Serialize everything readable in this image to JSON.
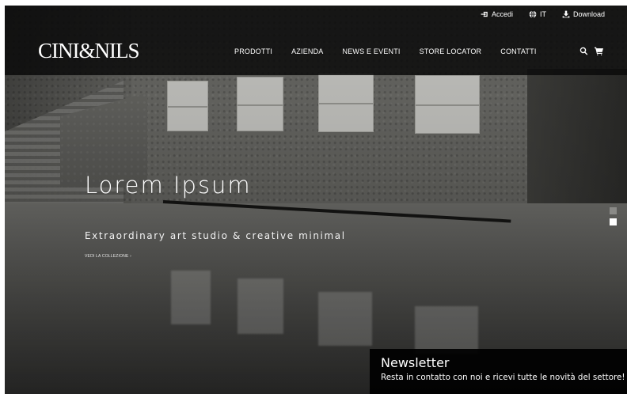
{
  "header": {
    "logo": "CINI&NILS",
    "top_links": [
      {
        "label": "Accedi",
        "icon": "login-icon"
      },
      {
        "label": "IT",
        "icon": "globe-icon"
      },
      {
        "label": "Download",
        "icon": "download-icon"
      }
    ],
    "nav": [
      {
        "label": "PRODOTTI"
      },
      {
        "label": "AZIENDA"
      },
      {
        "label": "NEWS E EVENTI"
      },
      {
        "label": "STORE LOCATOR"
      },
      {
        "label": "CONTATTI"
      }
    ],
    "tools": [
      "search-icon",
      "cart-icon"
    ]
  },
  "hero": {
    "title": "Lorem Ipsum",
    "subtitle": "Extraordinary art studio & creative minimal",
    "link": "VEDI LA COLLEZIONE ›",
    "slide_count": 2,
    "active_slide": 2
  },
  "newsletter": {
    "title": "Newsletter",
    "text": "Resta in contatto con noi e ricevi tutte le novità del settore!"
  },
  "colors": {
    "header_bg": "#0a0a0a",
    "text": "#ffffff",
    "dot_inactive": "#8a8a87",
    "dot_active": "#ffffff"
  }
}
